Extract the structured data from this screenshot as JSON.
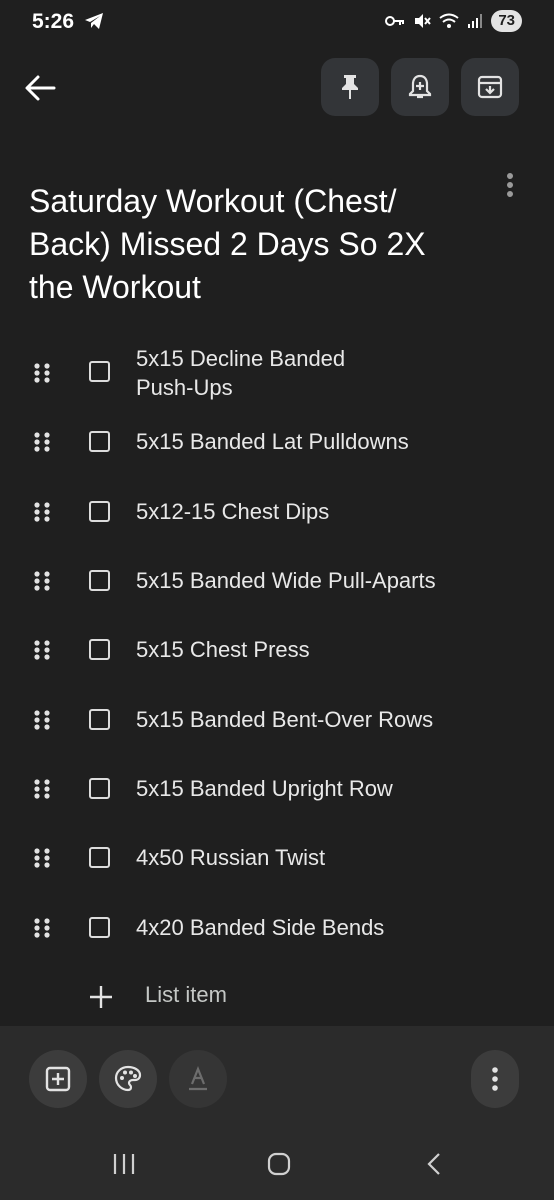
{
  "status": {
    "time": "5:26",
    "battery": "73"
  },
  "toolbar": {
    "pin_icon": "pin-icon",
    "reminder_icon": "bell-plus-icon",
    "archive_icon": "archive-icon"
  },
  "note": {
    "title": "Saturday Workout (Chest/ Back) Missed 2 Days So 2X the Workout",
    "items": [
      {
        "text": "5x15 Decline Banded Push-Ups",
        "checked": false
      },
      {
        "text": "5x15 Banded Lat Pulldowns",
        "checked": false
      },
      {
        "text": "5x12-15 Chest Dips",
        "checked": false
      },
      {
        "text": "5x15 Banded Wide Pull-Aparts",
        "checked": false
      },
      {
        "text": "5x15 Chest Press",
        "checked": false
      },
      {
        "text": "5x15 Banded Bent-Over Rows",
        "checked": false
      },
      {
        "text": "5x15 Banded Upright Row",
        "checked": false
      },
      {
        "text": "4x50 Russian Twist",
        "checked": false
      },
      {
        "text": "4x20 Banded Side Bends",
        "checked": false
      }
    ],
    "add_item_label": "List item"
  },
  "colors": {
    "background": "#1f1f1f",
    "bottom_bar": "#2b2b2b",
    "button": "#333538"
  }
}
